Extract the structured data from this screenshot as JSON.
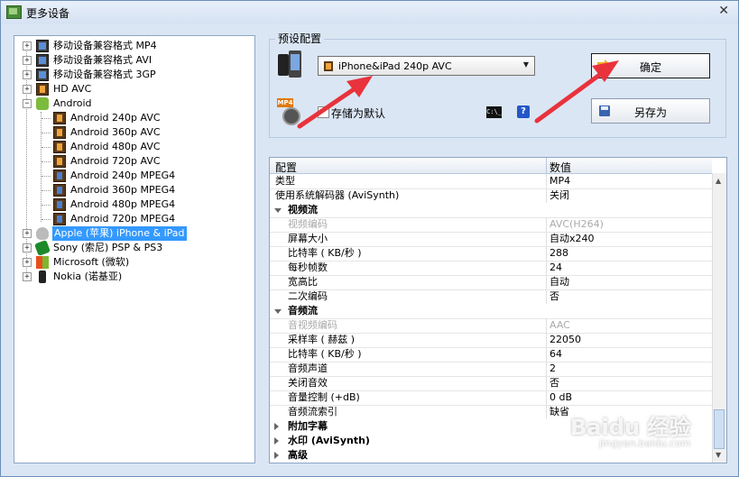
{
  "window": {
    "title": "更多设备",
    "close_glyph": "✕"
  },
  "tree": {
    "items": [
      {
        "label": "移动设备兼容格式 MP4",
        "icon": "phones-icon",
        "expander": "+"
      },
      {
        "label": "移动设备兼容格式 AVI",
        "icon": "phones-icon",
        "expander": "+"
      },
      {
        "label": "移动设备兼容格式 3GP",
        "icon": "phones-icon",
        "expander": "+"
      },
      {
        "label": "HD AVC",
        "icon": "film-icon",
        "expander": "+"
      },
      {
        "label": "Android",
        "icon": "android-icon",
        "expander": "−"
      },
      {
        "label": "Android 240p AVC",
        "icon": "film-icon"
      },
      {
        "label": "Android 360p AVC",
        "icon": "film-icon"
      },
      {
        "label": "Android 480p AVC",
        "icon": "film-icon"
      },
      {
        "label": "Android 720p AVC",
        "icon": "film-icon"
      },
      {
        "label": "Android 240p MPEG4",
        "icon": "film-blue-icon"
      },
      {
        "label": "Android 360p MPEG4",
        "icon": "film-blue-icon"
      },
      {
        "label": "Android 480p MPEG4",
        "icon": "film-blue-icon"
      },
      {
        "label": "Android 720p MPEG4",
        "icon": "film-blue-icon"
      },
      {
        "label": "Apple (苹果) iPhone & iPad",
        "icon": "apple-icon",
        "expander": "+"
      },
      {
        "label": "Sony (索尼) PSP & PS3",
        "icon": "sony-icon",
        "expander": "+"
      },
      {
        "label": "Microsoft (微软)",
        "icon": "windows-icon",
        "expander": "+"
      },
      {
        "label": "Nokia (诺基亚)",
        "icon": "nokia-icon",
        "expander": "+"
      }
    ]
  },
  "preset": {
    "group_label": "预设配置",
    "selected": "iPhone&iPad 240p AVC",
    "save_default_label": "存储为默认",
    "cmd_glyph": "C:\\_",
    "help_glyph": "?"
  },
  "buttons": {
    "ok": "确定",
    "save_as": "另存为"
  },
  "grid": {
    "headers": [
      "配置",
      "数值"
    ],
    "rows": [
      {
        "name": "类型",
        "value": "MP4"
      },
      {
        "name": "使用系统解码器 (AviSynth)",
        "value": "关闭"
      },
      {
        "name": "视频流",
        "value": ""
      },
      {
        "name": "视频编码",
        "value": "AVC(H264)"
      },
      {
        "name": "屏幕大小",
        "value": "自动x240"
      },
      {
        "name": "比特率 ( KB/秒 )",
        "value": "288"
      },
      {
        "name": "每秒帧数",
        "value": "24"
      },
      {
        "name": "宽高比",
        "value": "自动"
      },
      {
        "name": "二次编码",
        "value": "否"
      },
      {
        "name": "音频流",
        "value": ""
      },
      {
        "name": "音视频编码",
        "value": "AAC"
      },
      {
        "name": "采样率 ( 赫兹 )",
        "value": "22050"
      },
      {
        "name": "比特率 ( KB/秒 )",
        "value": "64"
      },
      {
        "name": "音频声道",
        "value": "2"
      },
      {
        "name": "关闭音效",
        "value": "否"
      },
      {
        "name": "音量控制 (+dB)",
        "value": "0 dB"
      },
      {
        "name": "音频流索引",
        "value": "缺省"
      },
      {
        "name": "附加字幕",
        "value": ""
      },
      {
        "name": "水印 (AviSynth)",
        "value": ""
      },
      {
        "name": "高级",
        "value": ""
      }
    ]
  },
  "watermark": {
    "text": "Baidu 经验",
    "sub": "jingyan.baidu.com"
  },
  "colors": {
    "selection": "#3399ff",
    "annotation_arrow": "#e8333c"
  }
}
